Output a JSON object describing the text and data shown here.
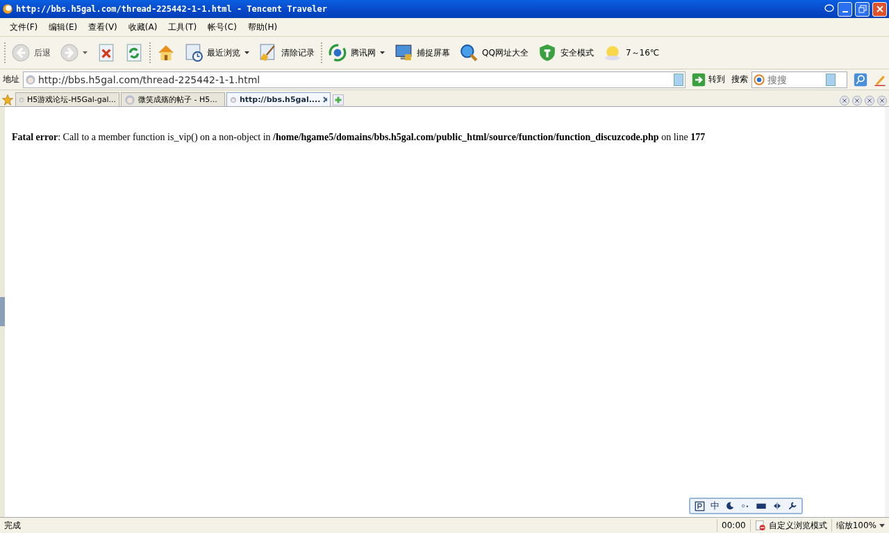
{
  "window": {
    "title": "http://bbs.h5gal.com/thread-225442-1-1.html - Tencent Traveler"
  },
  "menu": [
    "文件(F)",
    "编辑(E)",
    "查看(V)",
    "收藏(A)",
    "工具(T)",
    "帐号(C)",
    "帮助(H)"
  ],
  "toolbar": {
    "groups": [
      [
        {
          "label": "后退",
          "disabled": true,
          "dropdown": false
        },
        {
          "disabled": true,
          "dropdown": true
        },
        {
          "disabled": false,
          "dropdown": false
        },
        {
          "disabled": false,
          "dropdown": false
        }
      ],
      [
        {
          "disabled": false,
          "dropdown": false
        },
        {
          "label": "最近浏览",
          "disabled": false,
          "dropdown": true
        },
        {
          "label": "清除记录",
          "disabled": false,
          "dropdown": false
        }
      ],
      [
        {
          "label": "腾讯网",
          "disabled": false,
          "dropdown": true
        },
        {
          "label": "捕捉屏幕",
          "disabled": false,
          "dropdown": false
        },
        {
          "label": "QQ网址大全",
          "disabled": false,
          "dropdown": false
        },
        {
          "label": "安全模式",
          "disabled": false,
          "dropdown": false
        },
        {
          "label": "7～16℃",
          "disabled": false,
          "dropdown": false
        }
      ]
    ]
  },
  "address_bar": {
    "label": "地址",
    "value": "http://bbs.h5gal.com/thread-225442-1-1.html",
    "go_button": "转到",
    "search_label": "搜索",
    "search": {
      "placeholder": "搜搜"
    }
  },
  "tabs": [
    {
      "label": "H5游戏论坛-H5Gal-gal...",
      "selected": false
    },
    {
      "label": "微笑成殇的帖子 - H5...",
      "selected": false
    },
    {
      "label": "http://bbs.h5gal....",
      "selected": true
    }
  ],
  "page": {
    "error": "**Fatal error**: Call to a member function is_vip() on a non-object in **/home/hgame5/domains/bbs.h5gal.com/public_html/source/function/function_discuzcode.php** on line **177**"
  },
  "ime_bar": {
    "mode": "中"
  },
  "status_bar": {
    "status": "完成",
    "time": "00:00",
    "mode": "自定义浏览模式",
    "zoom": "缩放100%"
  }
}
